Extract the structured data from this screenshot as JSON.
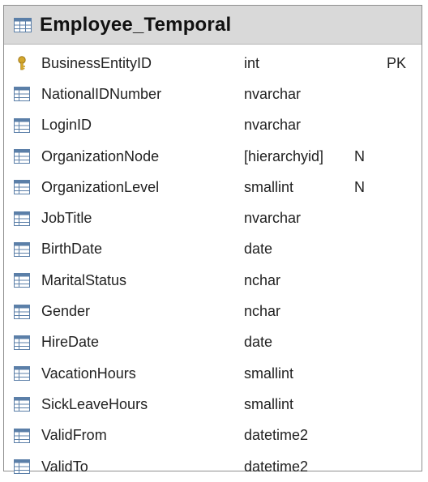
{
  "table": {
    "title": "Employee_Temporal",
    "columns": [
      {
        "name": "BusinessEntityID",
        "type": "int",
        "key": "PK",
        "icon": "key-icon"
      },
      {
        "name": "NationalIDNumber",
        "type": "nvarchar",
        "key": "",
        "icon": "column-icon"
      },
      {
        "name": "LoginID",
        "type": "nvarchar",
        "key": "",
        "icon": "column-icon"
      },
      {
        "name": "OrganizationNode",
        "type": "[hierarchyid]",
        "key": "N",
        "icon": "column-icon"
      },
      {
        "name": "OrganizationLevel",
        "type": "smallint",
        "key": "N",
        "icon": "column-icon"
      },
      {
        "name": "JobTitle",
        "type": "nvarchar",
        "key": "",
        "icon": "column-icon"
      },
      {
        "name": "BirthDate",
        "type": "date",
        "key": "",
        "icon": "column-icon"
      },
      {
        "name": "MaritalStatus",
        "type": "nchar",
        "key": "",
        "icon": "column-icon"
      },
      {
        "name": "Gender",
        "type": "nchar",
        "key": "",
        "icon": "column-icon"
      },
      {
        "name": "HireDate",
        "type": "date",
        "key": "",
        "icon": "column-icon"
      },
      {
        "name": "VacationHours",
        "type": "smallint",
        "key": "",
        "icon": "column-icon"
      },
      {
        "name": "SickLeaveHours",
        "type": "smallint",
        "key": "",
        "icon": "column-icon"
      },
      {
        "name": "ValidFrom",
        "type": "datetime2",
        "key": "",
        "icon": "column-icon"
      },
      {
        "name": "ValidTo",
        "type": "datetime2",
        "key": "",
        "icon": "column-icon"
      }
    ]
  },
  "colors": {
    "header_bg": "#d9d9d9",
    "icon_blue": "#5b7fa8",
    "key_gold": "#d4a72c"
  }
}
